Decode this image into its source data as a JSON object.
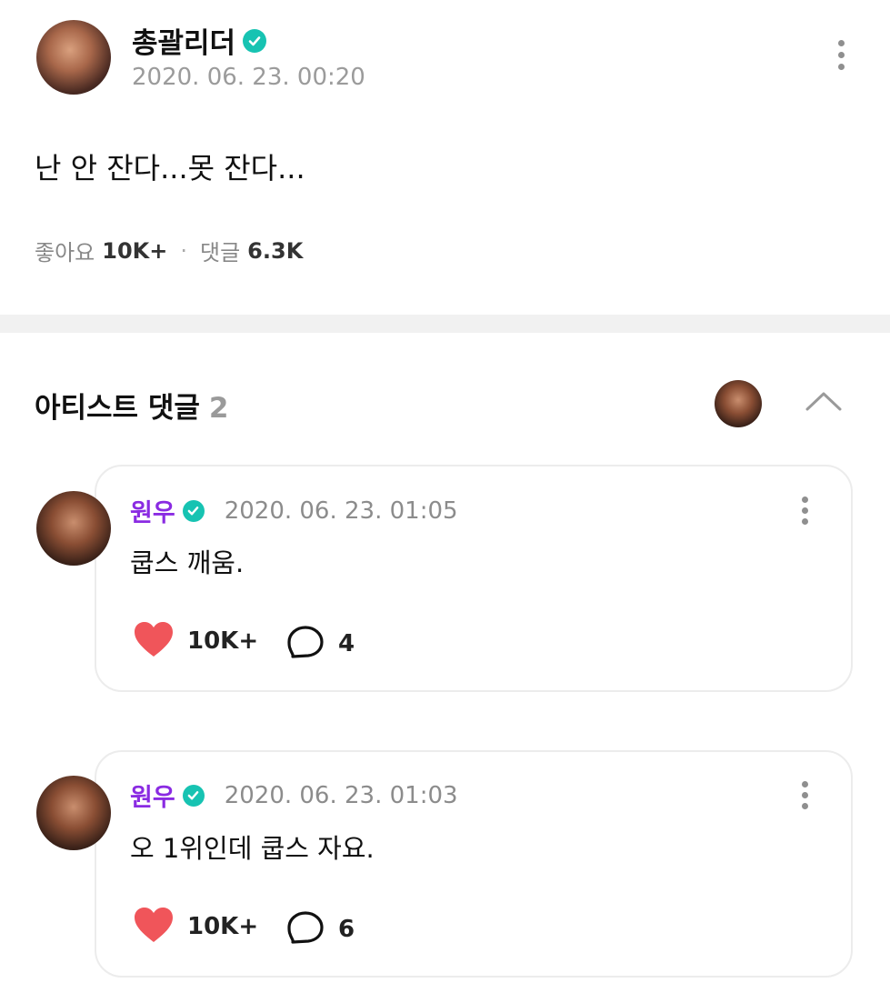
{
  "post": {
    "author": "총괄리더",
    "timestamp": "2020. 06. 23. 00:20",
    "body": "난 안 잔다...못 잔다...",
    "likes_label": "좋아요",
    "likes_count": "10K+",
    "separator": "·",
    "comments_label": "댓글",
    "comments_count": "6.3K"
  },
  "artist_comments": {
    "title": "아티스트 댓글",
    "count": "2",
    "items": [
      {
        "author": "원우",
        "timestamp": "2020. 06. 23. 01:05",
        "text": "쿱스 깨움.",
        "likes": "10K+",
        "replies": "4"
      },
      {
        "author": "원우",
        "timestamp": "2020. 06. 23. 01:03",
        "text": "오 1위인데 쿱스 자요.",
        "likes": "10K+",
        "replies": "6"
      }
    ]
  },
  "colors": {
    "verified_badge": "#17c3b2",
    "artist_name": "#8a2be2",
    "heart": "#f0555a"
  },
  "icons": [
    "verified-badge-icon",
    "more-vertical-icon",
    "chevron-up-icon",
    "heart-icon",
    "comment-bubble-icon"
  ]
}
